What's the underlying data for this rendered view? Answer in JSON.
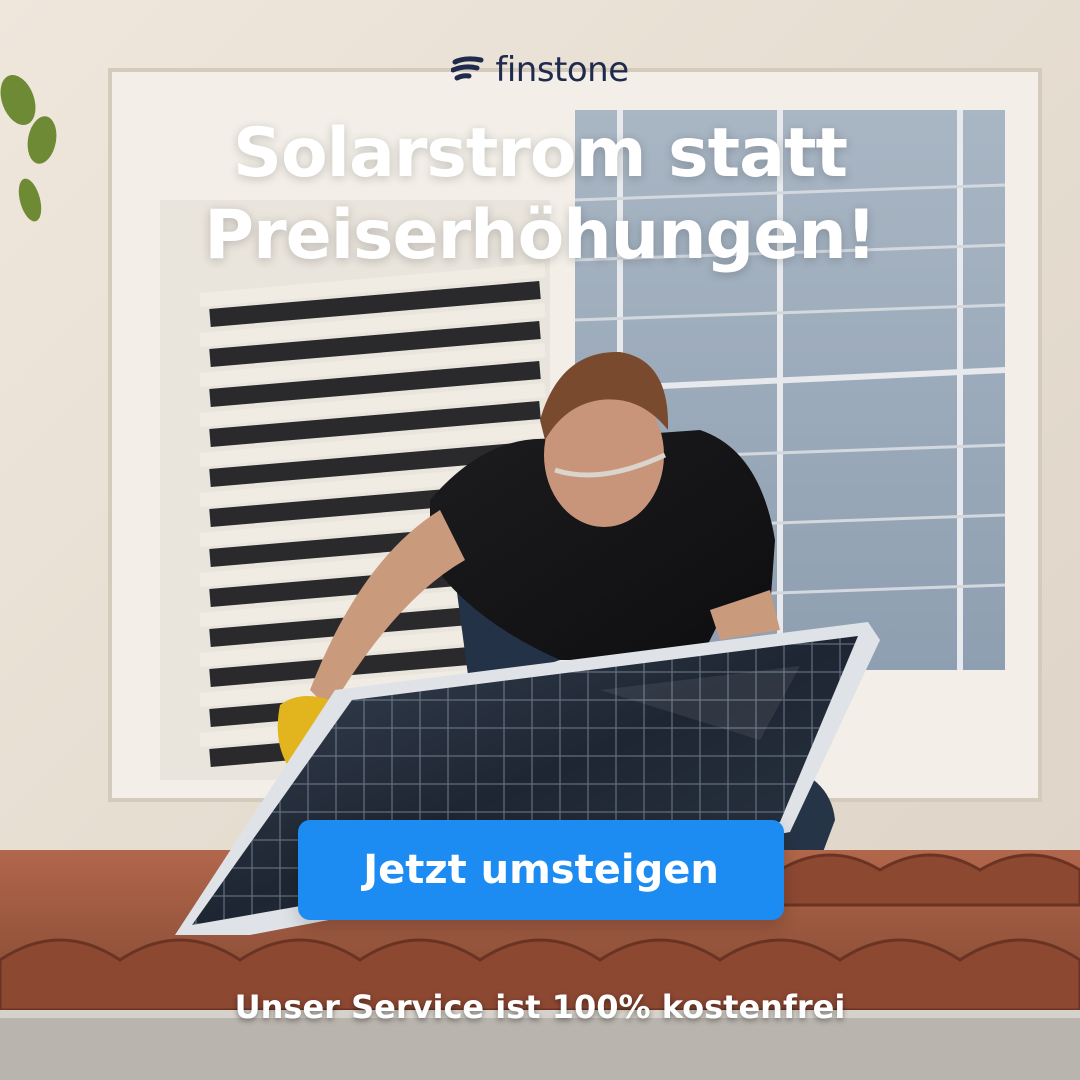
{
  "brand": {
    "name": "finstone",
    "logo_icon": "finstone-mark-icon",
    "color": "#1f2a4d"
  },
  "headline": {
    "line1": "Solarstrom statt",
    "line2": "Preiserhöhungen!"
  },
  "cta": {
    "label": "Jetzt umsteigen",
    "color": "#1c8bf2"
  },
  "footer": {
    "note": "Unser Service ist 100% kostenfrei"
  },
  "photo": {
    "subject": "man-installing-solar-panel-on-roof"
  }
}
